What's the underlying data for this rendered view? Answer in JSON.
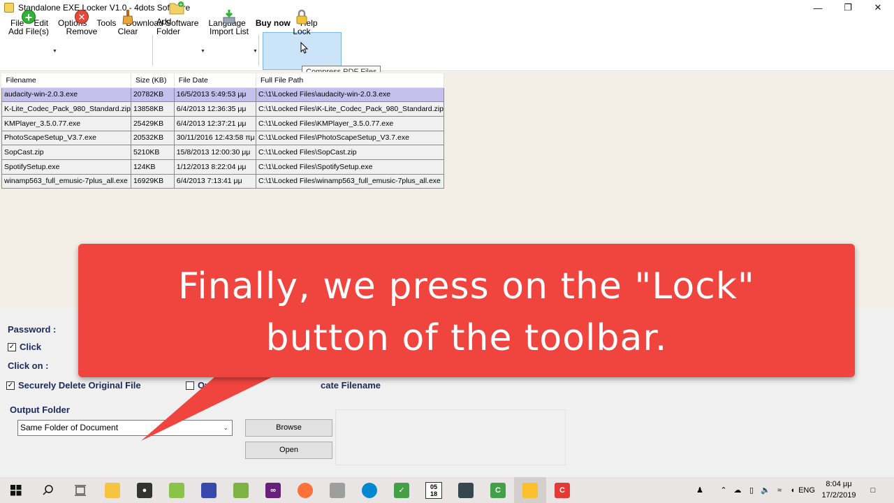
{
  "window": {
    "title": "Standalone EXE Locker V1.0 - 4dots Software"
  },
  "menu": [
    "File",
    "Edit",
    "Options",
    "Tools",
    "Download Software",
    "Language",
    "Buy now",
    "Help"
  ],
  "toolbar": {
    "add_files": "Add File(s)",
    "remove": "Remove",
    "clear": "Clear",
    "add_folder": "Add Folder",
    "import_list": "Import List",
    "lock": "Lock",
    "tooltip": "Compress PDF Files"
  },
  "grid": {
    "headers": [
      "Filename",
      "Size (KB)",
      "File Date",
      "Full File Path"
    ],
    "rows": [
      [
        "audacity-win-2.0.3.exe",
        "20782KB",
        "16/5/2013 5:49:53 μμ",
        "C:\\1\\Locked Files\\audacity-win-2.0.3.exe"
      ],
      [
        "K-Lite_Codec_Pack_980_Standard.zip",
        "13858KB",
        "6/4/2013 12:36:35 μμ",
        "C:\\1\\Locked Files\\K-Lite_Codec_Pack_980_Standard.zip"
      ],
      [
        "KMPlayer_3.5.0.77.exe",
        "25429KB",
        "6/4/2013 12:37:21 μμ",
        "C:\\1\\Locked Files\\KMPlayer_3.5.0.77.exe"
      ],
      [
        "PhotoScapeSetup_V3.7.exe",
        "20532KB",
        "30/11/2016 12:43:58 πμ",
        "C:\\1\\Locked Files\\PhotoScapeSetup_V3.7.exe"
      ],
      [
        "SopCast.zip",
        "5210KB",
        "15/8/2013 12:00:30 μμ",
        "C:\\1\\Locked Files\\SopCast.zip"
      ],
      [
        "SpotifySetup.exe",
        "124KB",
        "1/12/2013 8:22:04 μμ",
        "C:\\1\\Locked Files\\SpotifySetup.exe"
      ],
      [
        "winamp563_full_emusic-7plus_all.exe",
        "16929KB",
        "6/4/2013 7:13:41 μμ",
        "C:\\1\\Locked Files\\winamp563_full_emusic-7plus_all.exe"
      ]
    ]
  },
  "options": {
    "password_label": "Password :",
    "click_label": "Click",
    "click_on_label": "Click on :",
    "secure_delete_label": "Securely Delete Original File",
    "overwrite_label": "Overwrite",
    "partial_label": "cate Filename",
    "output_folder_label": "Output Folder",
    "output_folder_value": "Same Folder of Document",
    "browse": "Browse",
    "open": "Open"
  },
  "callout": {
    "line1": "Finally, we press on the \"Lock\"",
    "line2": "button of the toolbar.",
    "color": "#f0443f"
  },
  "taskbar": {
    "calendar_top": "05",
    "calendar_bottom": "18",
    "lang": "ENG",
    "time": "8:04 μμ",
    "date": "17/2/2019"
  }
}
